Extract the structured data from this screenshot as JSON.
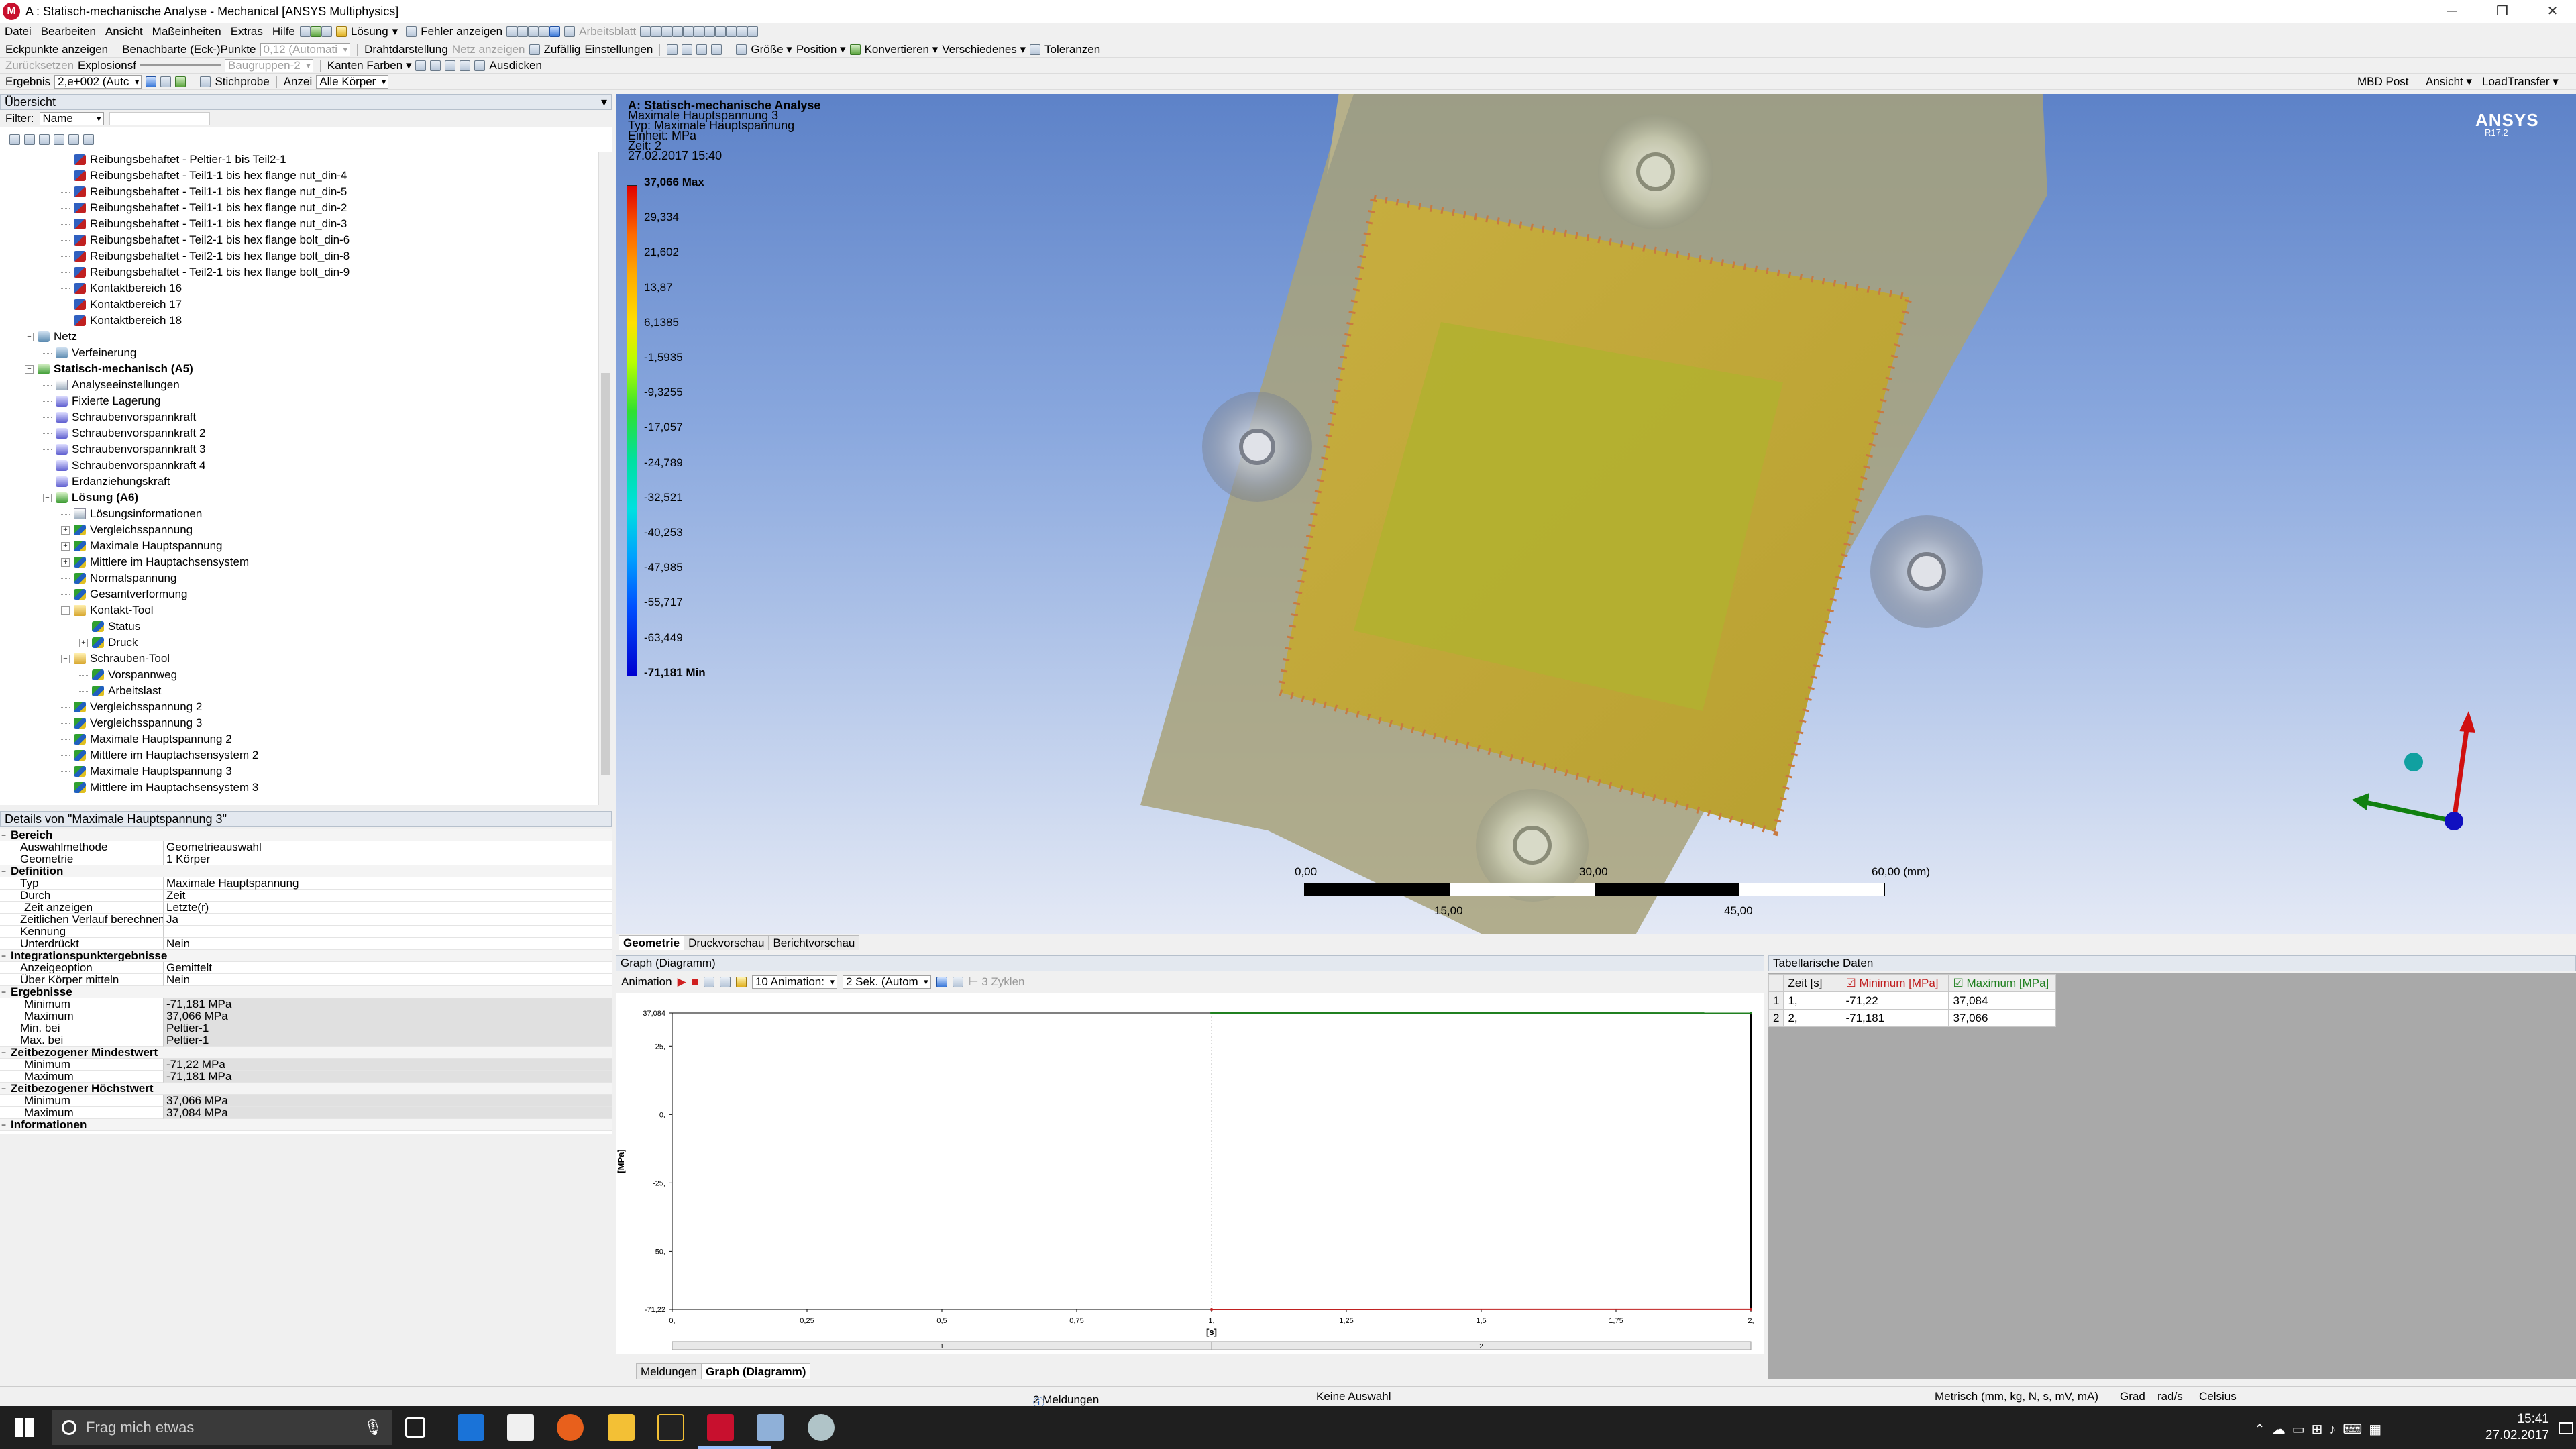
{
  "window": {
    "title": "A : Statisch-mechanische Analyse - Mechanical [ANSYS Multiphysics]",
    "app_icon": "M",
    "controls": [
      "─",
      "❐",
      "✕"
    ]
  },
  "menu": {
    "items": [
      "Datei",
      "Bearbeiten",
      "Ansicht",
      "Maßeinheiten",
      "Extras",
      "Hilfe"
    ],
    "loesung": "Lösung",
    "fehler": "Fehler anzeigen",
    "arbeitsblatt": "Arbeitsblatt"
  },
  "toolbar1": {
    "eckpunkte": "Eckpunkte anzeigen",
    "benachbarte": "Benachbarte (Eck-)Punkte",
    "automat": "0,12 (Automati",
    "drahtdarstellung": "Drahtdarstellung",
    "netz_anzeigen": "Netz anzeigen",
    "zufallig": "Zufällig",
    "einstellungen": "Einstellungen",
    "groesse": "Größe",
    "position": "Position",
    "konvertieren": "Konvertieren",
    "verschiedenes": "Verschiedenes",
    "toleranzen": "Toleranzen"
  },
  "toolbar2": {
    "zuruecksetzen": "Zurücksetzen",
    "explosion": "Explosionsf",
    "baugruppen": "Baugruppen-2",
    "kanten_farben": "Kanten Farben",
    "ausdicken": "Ausdicken"
  },
  "toolbar3": {
    "ergebnis": "Ergebnis",
    "scale": "2,e+002 (Autc",
    "stichprobe": "Stichprobe",
    "anzeige": "Anzei",
    "alle_koerper": "Alle Körper",
    "mbd_post": "MBD Post",
    "ansicht": "Ansicht",
    "loadtransfer": "LoadTransfer"
  },
  "outline": {
    "header": "Übersicht",
    "filter_label": "Filter:",
    "filter_value": "Name",
    "nodes": [
      {
        "label": "Reibungsbehaftet - Peltier-1 bis Teil2-1",
        "level": 4,
        "icon": "contact"
      },
      {
        "label": "Reibungsbehaftet - Teil1-1 bis hex flange nut_din-4",
        "level": 4,
        "icon": "contact"
      },
      {
        "label": "Reibungsbehaftet - Teil1-1 bis hex flange nut_din-5",
        "level": 4,
        "icon": "contact"
      },
      {
        "label": "Reibungsbehaftet - Teil1-1 bis hex flange nut_din-2",
        "level": 4,
        "icon": "contact"
      },
      {
        "label": "Reibungsbehaftet - Teil1-1 bis hex flange nut_din-3",
        "level": 4,
        "icon": "contact"
      },
      {
        "label": "Reibungsbehaftet - Teil2-1 bis hex flange bolt_din-6",
        "level": 4,
        "icon": "contact"
      },
      {
        "label": "Reibungsbehaftet - Teil2-1 bis hex flange bolt_din-8",
        "level": 4,
        "icon": "contact"
      },
      {
        "label": "Reibungsbehaftet - Teil2-1 bis hex flange bolt_din-9",
        "level": 4,
        "icon": "contact"
      },
      {
        "label": "Kontaktbereich 16",
        "level": 4,
        "icon": "contact"
      },
      {
        "label": "Kontaktbereich 17",
        "level": 4,
        "icon": "contact"
      },
      {
        "label": "Kontaktbereich 18",
        "level": 4,
        "icon": "contact"
      },
      {
        "label": "Netz",
        "level": 2,
        "icon": "mesh",
        "expander": "−"
      },
      {
        "label": "Verfeinerung",
        "level": 3,
        "icon": "mesh"
      },
      {
        "label": "Statisch-mechanisch (A5)",
        "level": 2,
        "icon": "check",
        "expander": "−",
        "bold": true
      },
      {
        "label": "Analyseeinstellungen",
        "level": 3,
        "icon": "info"
      },
      {
        "label": "Fixierte Lagerung",
        "level": 3,
        "icon": "load"
      },
      {
        "label": "Schraubenvorspannkraft",
        "level": 3,
        "icon": "load"
      },
      {
        "label": "Schraubenvorspannkraft 2",
        "level": 3,
        "icon": "load"
      },
      {
        "label": "Schraubenvorspannkraft 3",
        "level": 3,
        "icon": "load"
      },
      {
        "label": "Schraubenvorspannkraft 4",
        "level": 3,
        "icon": "load"
      },
      {
        "label": "Erdanziehungskraft",
        "level": 3,
        "icon": "load"
      },
      {
        "label": "Lösung (A6)",
        "level": 3,
        "icon": "check",
        "expander": "−",
        "bold": true
      },
      {
        "label": "Lösungsinformationen",
        "level": 4,
        "icon": "info"
      },
      {
        "label": "Vergleichsspannung",
        "level": 4,
        "icon": "result",
        "expander": "+"
      },
      {
        "label": "Maximale Hauptspannung",
        "level": 4,
        "icon": "result",
        "expander": "+"
      },
      {
        "label": "Mittlere im Hauptachsensystem",
        "level": 4,
        "icon": "result",
        "expander": "+"
      },
      {
        "label": "Normalspannung",
        "level": 4,
        "icon": "result"
      },
      {
        "label": "Gesamtverformung",
        "level": 4,
        "icon": "result"
      },
      {
        "label": "Kontakt-Tool",
        "level": 4,
        "icon": "folder",
        "expander": "−"
      },
      {
        "label": "Status",
        "level": 5,
        "icon": "result"
      },
      {
        "label": "Druck",
        "level": 5,
        "icon": "result",
        "expander": "+"
      },
      {
        "label": "Schrauben-Tool",
        "level": 4,
        "icon": "folder",
        "expander": "−"
      },
      {
        "label": "Vorspannweg",
        "level": 5,
        "icon": "result"
      },
      {
        "label": "Arbeitslast",
        "level": 5,
        "icon": "result"
      },
      {
        "label": "Vergleichsspannung 2",
        "level": 4,
        "icon": "result"
      },
      {
        "label": "Vergleichsspannung 3",
        "level": 4,
        "icon": "result"
      },
      {
        "label": "Maximale Hauptspannung 2",
        "level": 4,
        "icon": "result"
      },
      {
        "label": "Mittlere im Hauptachsensystem 2",
        "level": 4,
        "icon": "result"
      },
      {
        "label": "Maximale Hauptspannung 3",
        "level": 4,
        "icon": "result"
      },
      {
        "label": "Mittlere im Hauptachsensystem 3",
        "level": 4,
        "icon": "result"
      }
    ]
  },
  "details": {
    "header": "Details von \"Maximale Hauptspannung 3\"",
    "rows": [
      {
        "type": "sec",
        "k": "Bereich"
      },
      {
        "k": "Auswahlmethode",
        "v": "Geometrieauswahl"
      },
      {
        "k": "Geometrie",
        "v": "1 Körper"
      },
      {
        "type": "sec",
        "k": "Definition"
      },
      {
        "k": "Typ",
        "v": "Maximale Hauptspannung"
      },
      {
        "k": "Durch",
        "v": "Zeit"
      },
      {
        "k": "Zeit anzeigen",
        "v": "Letzte(r)",
        "sub": true
      },
      {
        "k": "Zeitlichen Verlauf berechnen",
        "v": "Ja"
      },
      {
        "k": "Kennung",
        "v": ""
      },
      {
        "k": "Unterdrückt",
        "v": "Nein"
      },
      {
        "type": "sec",
        "k": "Integrationspunktergebnisse"
      },
      {
        "k": "Anzeigeoption",
        "v": "Gemittelt"
      },
      {
        "k": "Über Körper mitteln",
        "v": "Nein"
      },
      {
        "type": "sec",
        "k": "Ergebnisse"
      },
      {
        "k": "Minimum",
        "v": "-71,181 MPa",
        "sub": true,
        "gray": true
      },
      {
        "k": "Maximum",
        "v": "37,066 MPa",
        "sub": true,
        "gray": true
      },
      {
        "k": "Min. bei",
        "v": "Peltier-1",
        "gray": true
      },
      {
        "k": "Max. bei",
        "v": "Peltier-1",
        "gray": true
      },
      {
        "type": "sec",
        "k": "Zeitbezogener Mindestwert"
      },
      {
        "k": "Minimum",
        "v": "-71,22 MPa",
        "sub": true,
        "gray": true
      },
      {
        "k": "Maximum",
        "v": "-71,181 MPa",
        "sub": true,
        "gray": true
      },
      {
        "type": "sec",
        "k": "Zeitbezogener Höchstwert"
      },
      {
        "k": "Minimum",
        "v": "37,066 MPa",
        "sub": true,
        "gray": true
      },
      {
        "k": "Maximum",
        "v": "37,084 MPa",
        "sub": true,
        "gray": true
      },
      {
        "type": "sec",
        "k": "Informationen"
      }
    ]
  },
  "viewport": {
    "title_lines": [
      "A: Statisch-mechanische Analyse",
      "Maximale Hauptspannung 3",
      "Typ: Maximale Hauptspannung",
      "Einheit: MPa",
      "Zeit: 2",
      "27.02.2017 15:40"
    ],
    "legend": [
      "37,066 Max",
      "29,334",
      "21,602",
      "13,87",
      "6,1385",
      "-1,5935",
      "-9,3255",
      "-17,057",
      "-24,789",
      "-32,521",
      "-40,253",
      "-47,985",
      "-55,717",
      "-63,449",
      "-71,181 Min"
    ],
    "logo": "ANSYS",
    "version": "R17.2",
    "scale_top": [
      "0,00",
      "30,00",
      "60,00 (mm)"
    ],
    "scale_bottom": [
      "15,00",
      "45,00"
    ],
    "axis_x": "X",
    "axis_y": "Y",
    "colors": {
      "plate": "#a8a27a",
      "inner": "#b2b030",
      "x_axis": "#d01010",
      "y_axis": "#108010",
      "z_axis": "#1010c0"
    }
  },
  "viewport_tabs": [
    "Geometrie",
    "Druckvorschau",
    "Berichtvorschau"
  ],
  "graph": {
    "header": "Graph (Diagramm)",
    "animation": "Animation",
    "frames": "10 Animation:",
    "duration": "2 Sek. (Autom",
    "cycles": "3 Zyklen",
    "ylabel": "[MPa]",
    "xlabel": "[s]",
    "yticks": [
      "37,084",
      "25,",
      "0,",
      "-25,",
      "-50,",
      "-71,22"
    ],
    "xticks": [
      "0,",
      "0,25",
      "0,5",
      "0,75",
      "1,",
      "1,25",
      "1,5",
      "1,75",
      "2,"
    ],
    "step_labels": [
      "1",
      "2"
    ],
    "tabs": [
      "Meldungen",
      "Graph (Diagramm)"
    ]
  },
  "chart_data": {
    "type": "line",
    "x": [
      1,
      2
    ],
    "series": [
      {
        "name": "Minimum [MPa]",
        "values": [
          -71.22,
          -71.181
        ]
      },
      {
        "name": "Maximum [MPa]",
        "values": [
          37.084,
          37.066
        ]
      }
    ],
    "xlabel": "[s]",
    "ylabel": "[MPa]",
    "xlim": [
      0,
      2
    ],
    "ylim": [
      -71.22,
      37.084
    ]
  },
  "table": {
    "header": "Tabellarische Daten",
    "columns": [
      "Zeit [s]",
      "Minimum [MPa]",
      "Maximum [MPa]"
    ],
    "rows": [
      [
        "1",
        "1,",
        "-71,22",
        "37,084"
      ],
      [
        "2",
        "2,",
        "-71,181",
        "37,066"
      ]
    ]
  },
  "status": {
    "messages": "2 Meldungen",
    "selection": "Keine Auswahl",
    "units": "Metrisch (mm, kg, N, s, mV, mA)",
    "angle": "Grad",
    "rot": "rad/s",
    "temp": "Celsius"
  },
  "taskbar": {
    "search_placeholder": "Frag mich etwas",
    "time": "15:41",
    "date": "27.02.2017"
  }
}
